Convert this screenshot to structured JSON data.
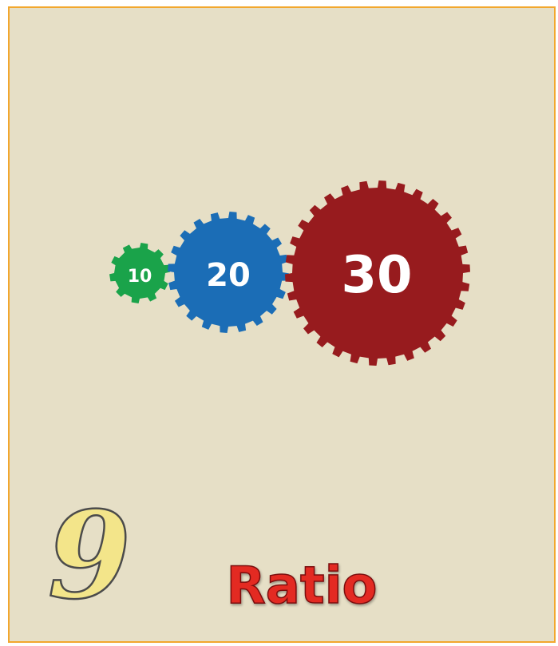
{
  "card": {
    "number": "9",
    "title": "Ratio"
  },
  "gears": [
    {
      "label": "10",
      "color": "#1aa34a",
      "teeth": 10
    },
    {
      "label": "20",
      "color": "#1b6db6",
      "teeth": 20
    },
    {
      "label": "30",
      "color": "#971b1e",
      "teeth": 30
    }
  ],
  "colors": {
    "background": "#e6dfc6",
    "border": "#f2a72e",
    "title": "#e32b22",
    "number_fill": "#f3e58a",
    "number_stroke": "#4b4b4b"
  }
}
